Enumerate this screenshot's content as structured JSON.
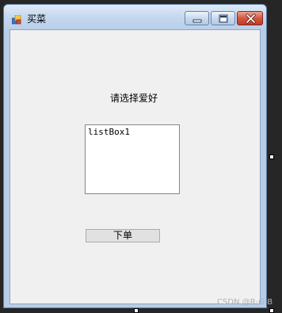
{
  "window": {
    "title": "买菜",
    "icon": "winforms-app-icon",
    "buttons": {
      "minimize_icon": "minimize-icon",
      "maximize_icon": "maximize-icon",
      "close_icon": "close-icon"
    }
  },
  "form": {
    "prompt_label": "请选择爱好",
    "listbox": {
      "items": [
        "listBox1"
      ]
    },
    "order_button_label": "下单"
  },
  "watermark": "CSDN @R-G-B",
  "colors": {
    "client_bg": "#f0f0f0",
    "titlebar": "#c3d6ed",
    "close_button": "#c23a26",
    "button_bg": "#e1e1e1"
  }
}
